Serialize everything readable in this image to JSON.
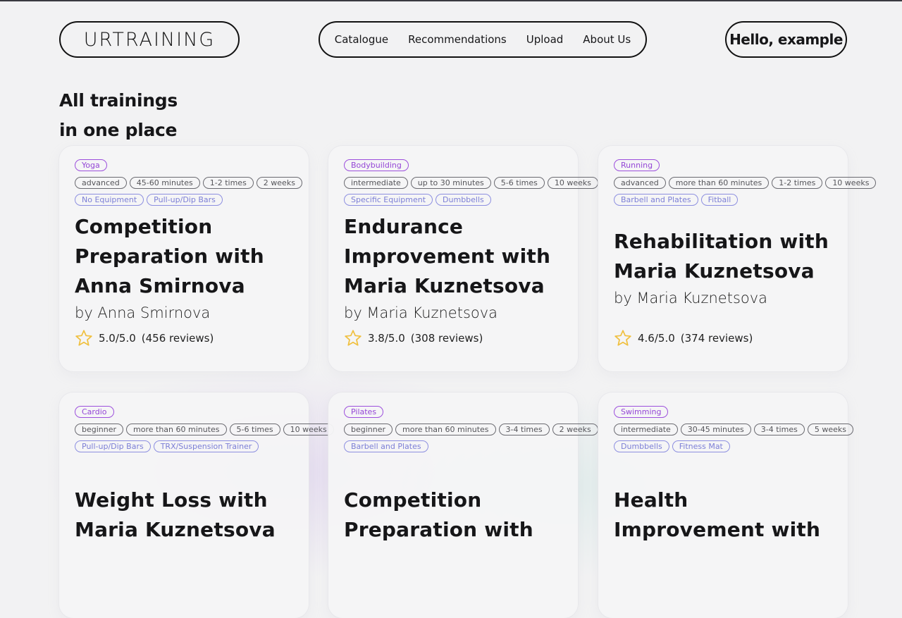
{
  "header": {
    "logo": "URTRAINING",
    "nav": [
      "Catalogue",
      "Recommendations",
      "Upload",
      "About Us"
    ],
    "greeting": "Hello, example"
  },
  "headline": [
    "All trainings",
    "in one place"
  ],
  "colors": {
    "category": "#9c4fdc",
    "meta": "#6a6a70",
    "equipment": "#8d8fe0",
    "star": "#f0c040"
  },
  "cards": [
    {
      "category": "Yoga",
      "meta": [
        "advanced",
        "45-60 minutes",
        "1-2 times",
        "2 weeks"
      ],
      "equipment": [
        "No Equipment",
        "Pull-up/Dip Bars"
      ],
      "title": "Competition Preparation with Anna Smirnova",
      "author": "by Anna Smirnova",
      "rating": "5.0/5.0",
      "reviews": "(456 reviews)"
    },
    {
      "category": "Bodybuilding",
      "meta": [
        "intermediate",
        "up to 30 minutes",
        "5-6 times",
        "10 weeks"
      ],
      "equipment": [
        "Specific Equipment",
        "Dumbbells"
      ],
      "title": "Endurance Improvement with Maria Kuznetsova",
      "author": "by Maria Kuznetsova",
      "rating": "3.8/5.0",
      "reviews": "(308 reviews)"
    },
    {
      "category": "Running",
      "meta": [
        "advanced",
        "more than 60 minutes",
        "1-2 times",
        "10 weeks"
      ],
      "equipment": [
        "Barbell and Plates",
        "Fitball"
      ],
      "title": "Rehabilitation with Maria Kuznetsova",
      "author": "by Maria Kuznetsova",
      "rating": "4.6/5.0",
      "reviews": "(374 reviews)"
    },
    {
      "category": "Cardio",
      "meta": [
        "beginner",
        "more than 60 minutes",
        "5-6 times",
        "10 weeks"
      ],
      "equipment": [
        "Pull-up/Dip Bars",
        "TRX/Suspension Trainer"
      ],
      "title": "Weight Loss with Maria Kuznetsova",
      "author": "",
      "rating": "",
      "reviews": ""
    },
    {
      "category": "Pilates",
      "meta": [
        "beginner",
        "more than 60 minutes",
        "3-4 times",
        "2 weeks"
      ],
      "equipment": [
        "Barbell and Plates"
      ],
      "title": "Competition Preparation with",
      "author": "",
      "rating": "",
      "reviews": ""
    },
    {
      "category": "Swimming",
      "meta": [
        "intermediate",
        "30-45 minutes",
        "3-4 times",
        "5 weeks"
      ],
      "equipment": [
        "Dumbbells",
        "Fitness Mat"
      ],
      "title": "Health Improvement with",
      "author": "",
      "rating": "",
      "reviews": ""
    }
  ]
}
